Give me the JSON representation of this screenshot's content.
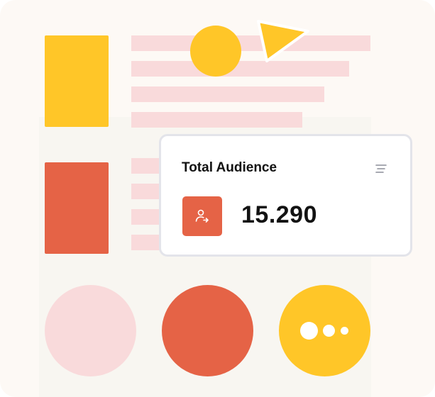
{
  "colors": {
    "background": "#fdf9f5",
    "panel": "#f8f6f1",
    "yellow": "#ffc628",
    "orange_red": "#e56346",
    "pink": "#f9dadb",
    "card_border": "#e3e4ea",
    "text": "#121212"
  },
  "card": {
    "title": "Total Audience",
    "value": "15.290",
    "menu_icon": "menu-lines-icon",
    "badge_icon": "user-share-icon"
  },
  "decor": {
    "cursor_icon": "cursor-arrow-icon",
    "dots_icon": "more-dots-icon"
  }
}
